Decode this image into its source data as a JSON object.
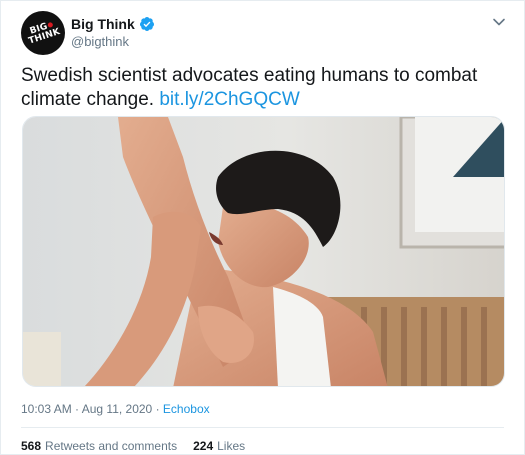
{
  "author": {
    "display_name": "Big Think",
    "handle": "@bigthink",
    "avatar_text_line1": "BIG",
    "avatar_text_line2": "THINK"
  },
  "tweet": {
    "text": "Swedish scientist advocates eating humans to combat climate change. ",
    "link_text": "bit.ly/2ChGQCW"
  },
  "meta": {
    "time": "10:03 AM",
    "separator": "·",
    "date": "Aug 11, 2020",
    "source": "Echobox"
  },
  "stats": {
    "retweets_count": "568",
    "retweets_label": "Retweets and comments",
    "likes_count": "224",
    "likes_label": "Likes"
  },
  "colors": {
    "link": "#1b95e0",
    "secondary": "#657786",
    "verified": "#1da1f2"
  }
}
